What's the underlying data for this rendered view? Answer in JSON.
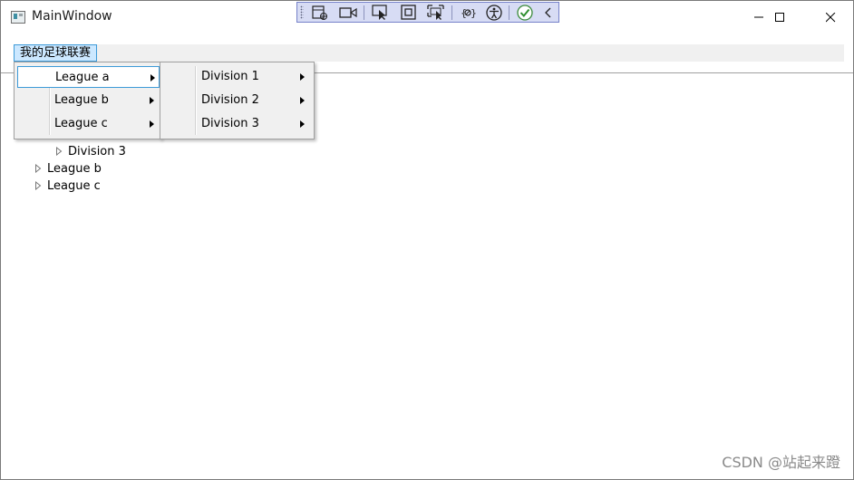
{
  "window": {
    "title": "MainWindow",
    "controls": {
      "minimize_icon": "minimize-icon",
      "maximize_icon": "maximize-icon",
      "close_icon": "close-icon"
    }
  },
  "devtools": {
    "tools": [
      "visual-tree-icon",
      "record-icon",
      "select-element-icon",
      "display-layout-adorners-icon",
      "track-focused-icon",
      "binding-failures-icon",
      "accessibility-icon",
      "hot-reload-ok-icon",
      "collapse-icon"
    ]
  },
  "menubar": {
    "root_label": "我的足球联赛"
  },
  "menu_leagues": [
    "League a",
    "League b",
    "League c"
  ],
  "menu_divisions": [
    "Division 1",
    "Division 2",
    "Division 3"
  ],
  "tree": {
    "rows": [
      "Division 3",
      "League b",
      "League c"
    ]
  },
  "watermark": "CSDN @站起来蹬",
  "colors": {
    "highlight_border": "#3d9ad8",
    "menu_bg": "#f0f0f0",
    "devbar_bg": "#d7dcf4"
  }
}
